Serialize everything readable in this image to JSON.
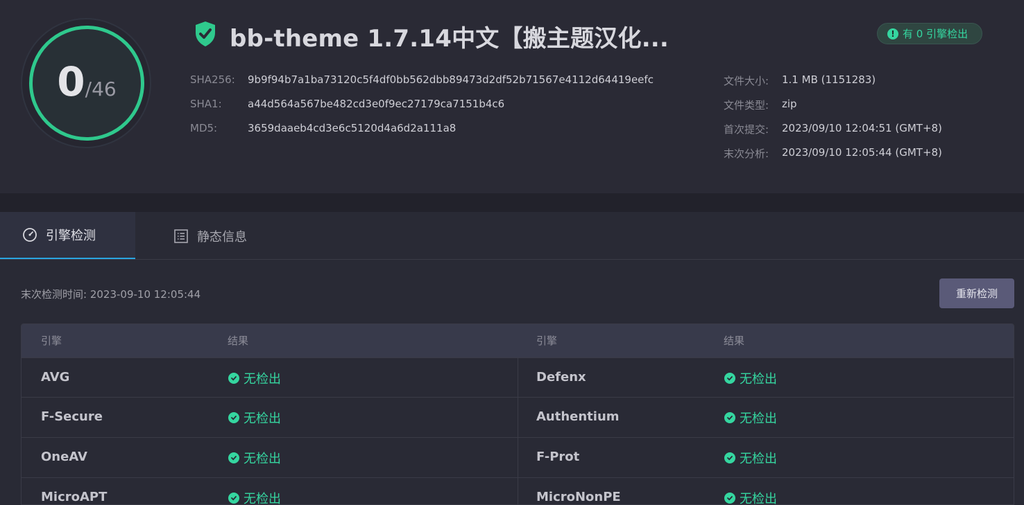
{
  "summary": {
    "detected": "0",
    "total": "/46",
    "ring_color": "#2fc98d"
  },
  "file": {
    "title": "bb-theme 1.7.14中文【搬主题汉化...",
    "status_icon": "shield-check-icon",
    "badge_icon": "exclamation-circle-icon",
    "badge_text": "有 0 引擎检出"
  },
  "hashes": [
    {
      "label": "SHA256:",
      "value": "9b9f94b7a1ba73120c5f4df0bb562dbb89473d2df52b71567e4112d64419eefc"
    },
    {
      "label": "SHA1:",
      "value": "a44d564a567be482cd3e0f9ec27179ca7151b4c6"
    },
    {
      "label": "MD5:",
      "value": "3659daaeb4cd3e6c5120d4a6d2a111a8"
    }
  ],
  "meta": [
    {
      "label": "文件大小:",
      "value": "1.1 MB (1151283)"
    },
    {
      "label": "文件类型:",
      "value": "zip"
    },
    {
      "label": "首次提交:",
      "value": "2023/09/10 12:04:51 (GMT+8)"
    },
    {
      "label": "末次分析:",
      "value": "2023/09/10 12:05:44 (GMT+8)"
    }
  ],
  "tabs": [
    {
      "label": "引擎检测",
      "icon": "gauge-icon",
      "active": true
    },
    {
      "label": "静态信息",
      "icon": "list-icon",
      "active": false
    }
  ],
  "detection": {
    "last_check": "末次检测时间: 2023-09-10 12:05:44",
    "recheck_button": "重新检测",
    "columns": [
      "引擎",
      "结果",
      "引擎",
      "结果"
    ],
    "rows": [
      {
        "left_engine": "AVG",
        "left_result": "无检出",
        "right_engine": "Defenx",
        "right_result": "无检出"
      },
      {
        "left_engine": "F-Secure",
        "left_result": "无检出",
        "right_engine": "Authentium",
        "right_result": "无检出"
      },
      {
        "left_engine": "OneAV",
        "left_result": "无检出",
        "right_engine": "F-Prot",
        "right_result": "无检出"
      },
      {
        "left_engine": "MicroAPT",
        "left_result": "无检出",
        "right_engine": "MicroNonPE",
        "right_result": "无检出"
      }
    ]
  },
  "colors": {
    "accent_green": "#35d6a0",
    "tab_underline": "#2aa5e0",
    "button_bg": "#5a5a78"
  }
}
